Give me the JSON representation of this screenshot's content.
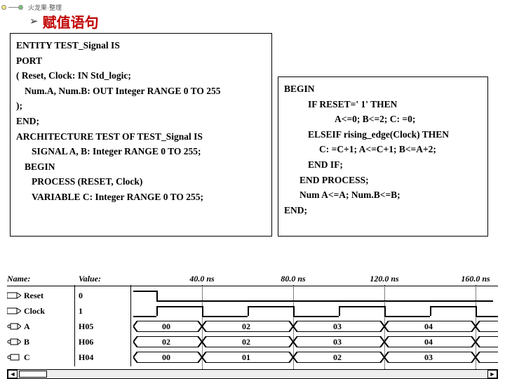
{
  "header": {
    "logo_text": "火龙果·整理",
    "title": "赋值语句"
  },
  "left_code": {
    "l1": "ENTITY TEST_Signal IS",
    "l2": "PORT",
    "l3": "( Reset, Clock: IN Std_logic;",
    "l4": "Num.A, Num.B: OUT Integer RANGE 0 TO 255",
    "l5": ");",
    "l6": "END;",
    "l7": "ARCHITECTURE TEST OF TEST_Signal IS",
    "l8": "SIGNAL A, B: Integer RANGE 0 TO 255;",
    "l9": "BEGIN",
    "l10": "PROCESS (RESET, Clock)",
    "l11": "VARIABLE C: Integer RANGE 0 TO 255;"
  },
  "right_code": {
    "l1": "BEGIN",
    "l2": "IF RESET=' 1' THEN",
    "l3": "A<=0; B<=2; C: =0;",
    "l4": "ELSEIF rising_edge(Clock) THEN",
    "l5": "C: =C+1; A<=C+1; B<=A+2;",
    "l6": "END IF;",
    "l7": "END PROCESS;",
    "l8": "Num A<=A; Num.B<=B;",
    "l9": "END;"
  },
  "timing": {
    "head_name": "Name:",
    "head_value": "Value:",
    "ticks": [
      "40.0 ns",
      "80.0 ns",
      "120.0 ns",
      "160.0 ns"
    ],
    "signals": [
      {
        "name": "Reset",
        "value": "0",
        "type": "digital"
      },
      {
        "name": "Clock",
        "value": "1",
        "type": "clock"
      },
      {
        "name": "A",
        "value": "H05",
        "type": "bus",
        "cells": [
          "00",
          "02",
          "03",
          "04"
        ]
      },
      {
        "name": "B",
        "value": "H06",
        "type": "bus",
        "cells": [
          "02",
          "02",
          "03",
          "04"
        ]
      },
      {
        "name": "C",
        "value": "H04",
        "type": "bus",
        "cells": [
          "00",
          "01",
          "02",
          "03"
        ]
      }
    ],
    "scroll_left": "◄",
    "scroll_right": "►"
  }
}
